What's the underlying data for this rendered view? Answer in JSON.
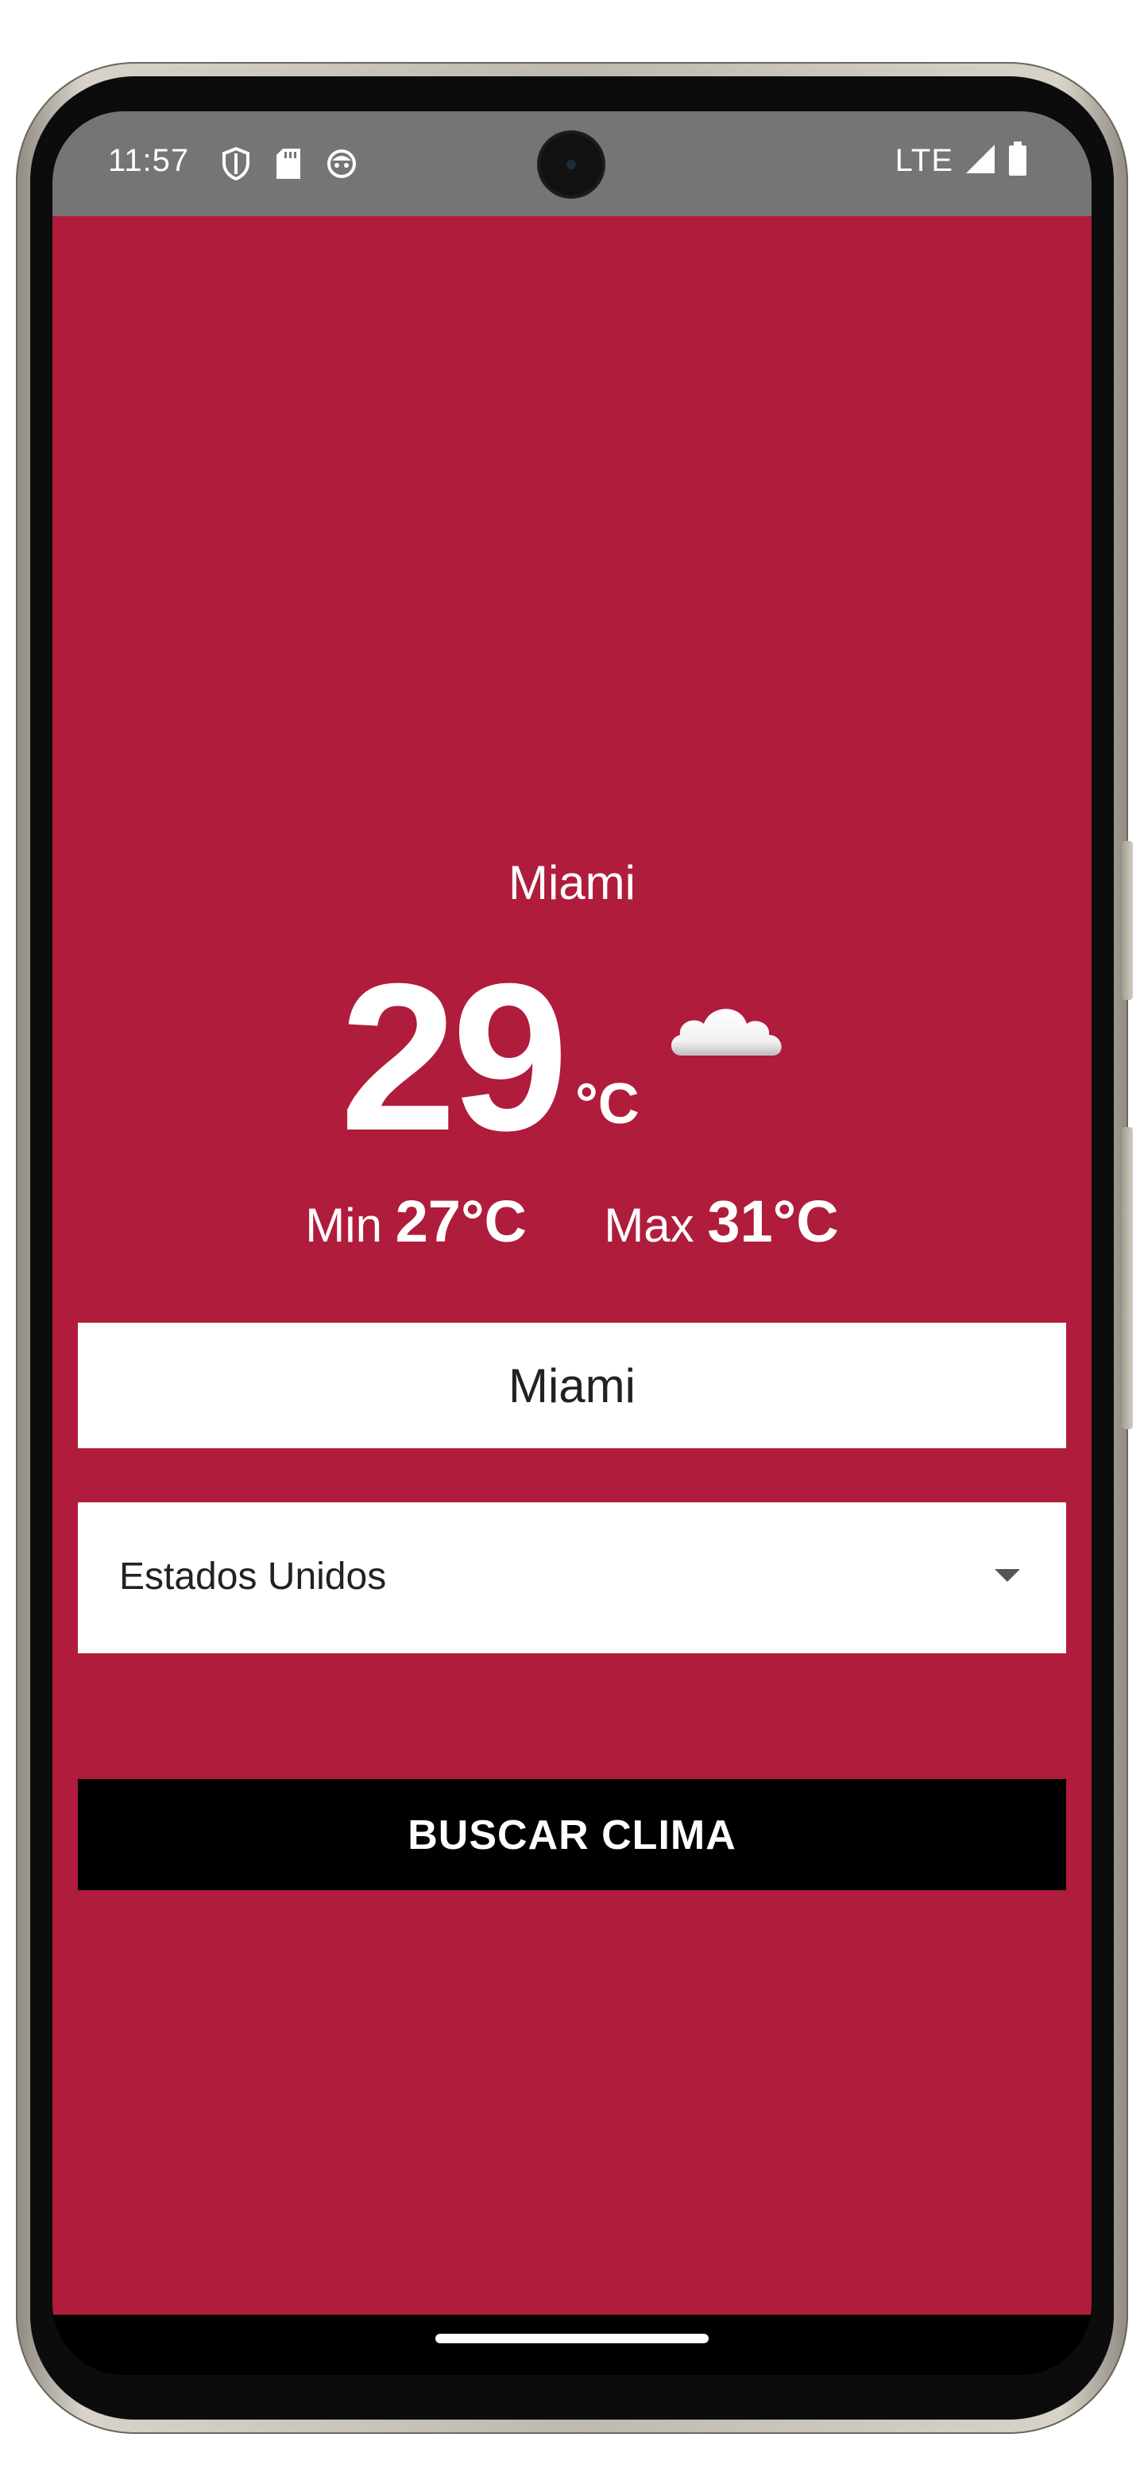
{
  "status_bar": {
    "time": "11:57",
    "left_icons": [
      "shield-icon",
      "sd-card-icon",
      "smiley-icon"
    ],
    "network": "LTE",
    "right_icons": [
      "signal-icon",
      "battery-icon"
    ]
  },
  "weather": {
    "city": "Miami",
    "temperature": "29",
    "unit": "°C",
    "condition_icon": "cloud-icon",
    "min_label": "Min",
    "min_value": "27°C",
    "max_label": "Max",
    "max_value": "31°C"
  },
  "form": {
    "city_input_value": "Miami",
    "country_selected": "Estados Unidos",
    "search_button_label": "BUSCAR CLIMA"
  },
  "colors": {
    "background": "#b01c3b",
    "status_bar": "#757575",
    "button": "#000000",
    "text": "#ffffff"
  }
}
